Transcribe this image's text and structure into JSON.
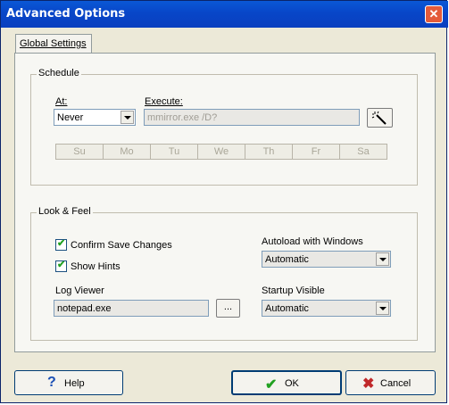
{
  "window": {
    "title": "Advanced Options",
    "close_glyph": "✕"
  },
  "tabs": [
    {
      "label": "Global Settings",
      "selected": true
    }
  ],
  "schedule": {
    "legend": "Schedule",
    "at_label": "At:",
    "at_value": "Never",
    "execute_label": "Execute:",
    "execute_value": "mmirror.exe /D?",
    "wizard_icon": "magic-wand-icon",
    "days": [
      "Su",
      "Mo",
      "Tu",
      "We",
      "Th",
      "Fr",
      "Sa"
    ]
  },
  "look_feel": {
    "legend": "Look & Feel",
    "confirm_save_label": "Confirm Save Changes",
    "confirm_save_checked": true,
    "show_hints_label": "Show Hints",
    "show_hints_checked": true,
    "log_viewer_label": "Log Viewer",
    "log_viewer_value": "notepad.exe",
    "browse_label": "...",
    "autoload_label": "Autoload with Windows",
    "autoload_value": "Automatic",
    "startup_label": "Startup Visible",
    "startup_value": "Automatic"
  },
  "buttons": {
    "help": {
      "label": "Help",
      "icon": "question-icon"
    },
    "ok": {
      "label": "OK",
      "icon": "checkmark-icon"
    },
    "cancel": {
      "label": "Cancel",
      "icon": "x-icon"
    }
  },
  "colors": {
    "title_bar": "#0a58d6",
    "ok_icon": "#21a121",
    "cancel_icon": "#c0282a",
    "help_icon": "#1a4fb5"
  }
}
